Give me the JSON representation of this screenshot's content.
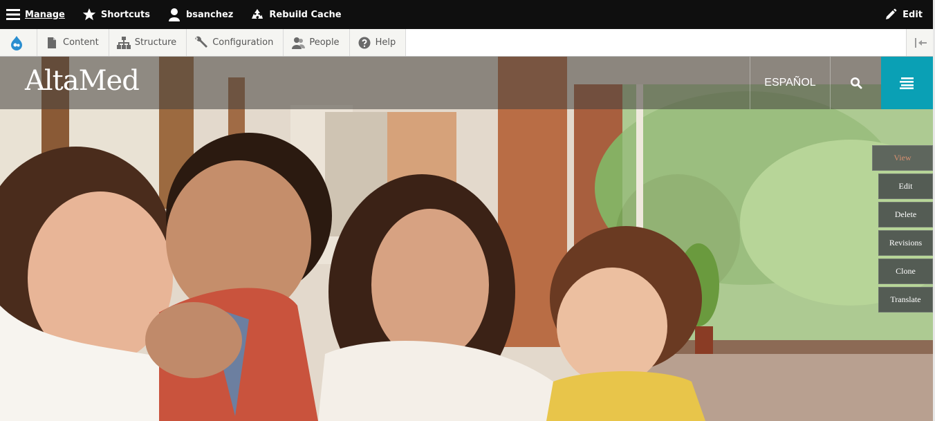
{
  "admin_bar": {
    "manage": "Manage",
    "shortcuts": "Shortcuts",
    "user": "bsanchez",
    "rebuild": "Rebuild Cache",
    "edit": "Edit"
  },
  "tray": {
    "tabs": [
      "Content",
      "Structure",
      "Configuration",
      "People",
      "Help"
    ]
  },
  "site": {
    "logo": "AltaMed",
    "language": "ESPAÑOL"
  },
  "tasks": [
    "View",
    "Edit",
    "Delete",
    "Revisions",
    "Clone",
    "Translate"
  ],
  "colors": {
    "admin_bg": "#0f0f0f",
    "menu_accent": "#0aa0b5",
    "task_bg": "#545c54",
    "active_task_text": "#d89070"
  }
}
